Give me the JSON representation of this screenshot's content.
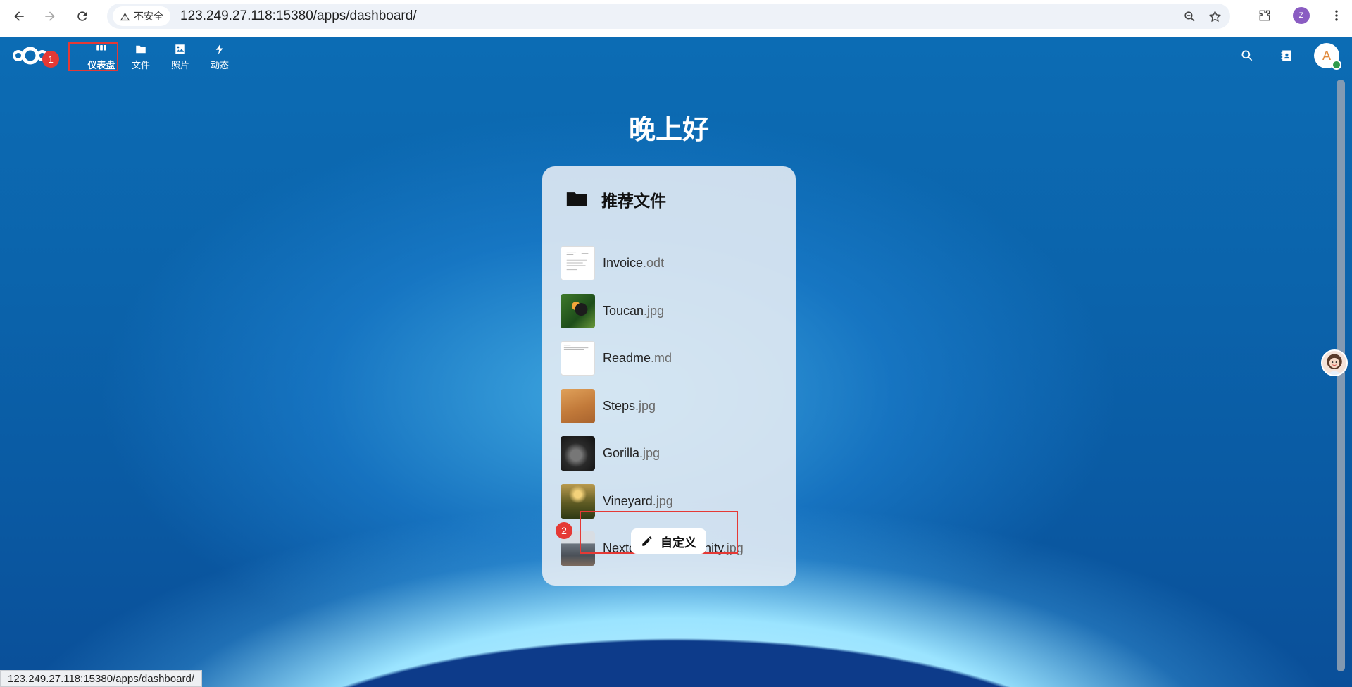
{
  "browser": {
    "security_label": "不安全",
    "url": "123.249.27.118:15380/apps/dashboard/",
    "profile_initial": "Z",
    "status_url": "123.249.27.118:15380/apps/dashboard/"
  },
  "topbar": {
    "apps": [
      {
        "label": "仪表盘",
        "icon": "dashboard-icon",
        "active": true
      },
      {
        "label": "文件",
        "icon": "folder-icon"
      },
      {
        "label": "照片",
        "icon": "image-icon"
      },
      {
        "label": "动态",
        "icon": "lightning-icon"
      }
    ],
    "avatar_initial": "A"
  },
  "annotations": [
    "1",
    "2"
  ],
  "greeting": "晚上好",
  "widget": {
    "title": "推荐文件",
    "files": [
      {
        "name": "Invoice",
        "ext": ".odt"
      },
      {
        "name": "Toucan",
        "ext": ".jpg"
      },
      {
        "name": "Readme",
        "ext": ".md"
      },
      {
        "name": "Steps",
        "ext": ".jpg"
      },
      {
        "name": "Gorilla",
        "ext": ".jpg"
      },
      {
        "name": "Vineyard",
        "ext": ".jpg"
      },
      {
        "name": "Nextcloud community",
        "ext": ".jpg"
      }
    ]
  },
  "customize_label": "自定义",
  "colors": {
    "accent": "#0b63ab",
    "annotation": "#e53935",
    "online": "#2e9b4d"
  }
}
